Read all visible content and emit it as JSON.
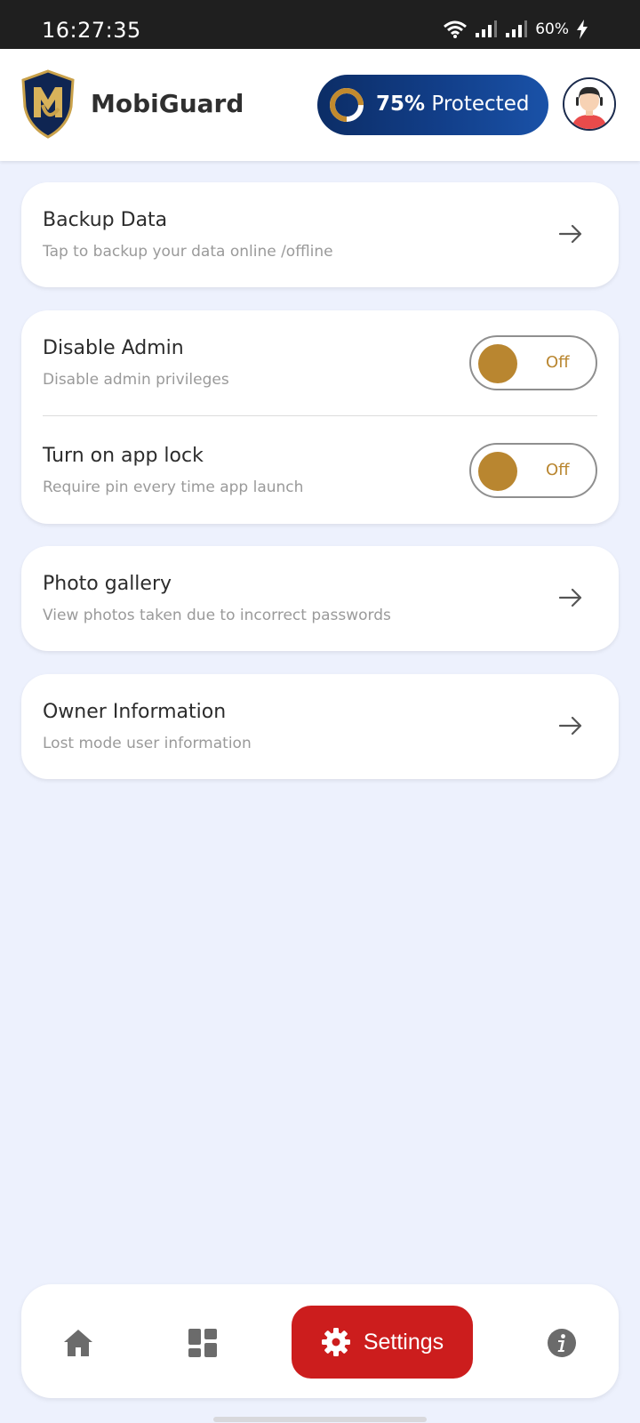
{
  "status_bar": {
    "time": "16:27:35",
    "battery": "60%"
  },
  "header": {
    "app_name": "MobiGuard",
    "protection_percent": "75%",
    "protection_label": "Protected",
    "protection_value": 0.75
  },
  "settings": {
    "backup": {
      "title": "Backup Data",
      "subtitle": "Tap to backup your data online /offline"
    },
    "disable_admin": {
      "title": "Disable Admin",
      "subtitle": "Disable admin privileges",
      "state": "Off"
    },
    "app_lock": {
      "title": "Turn on app lock",
      "subtitle": "Require pin every time app launch",
      "state": "Off"
    },
    "photo_gallery": {
      "title": "Photo gallery",
      "subtitle": "View photos taken due to incorrect passwords"
    },
    "owner_info": {
      "title": "Owner Information",
      "subtitle": "Lost mode user information"
    }
  },
  "bottom_nav": {
    "active_label": "Settings",
    "items": [
      "home-icon",
      "dashboard-icon",
      "settings-icon",
      "info-icon"
    ]
  },
  "colors": {
    "accent_gold": "#b98630",
    "nav_active": "#cc1d1d",
    "header_pill": "#123f8a",
    "background": "#edf1fd"
  }
}
